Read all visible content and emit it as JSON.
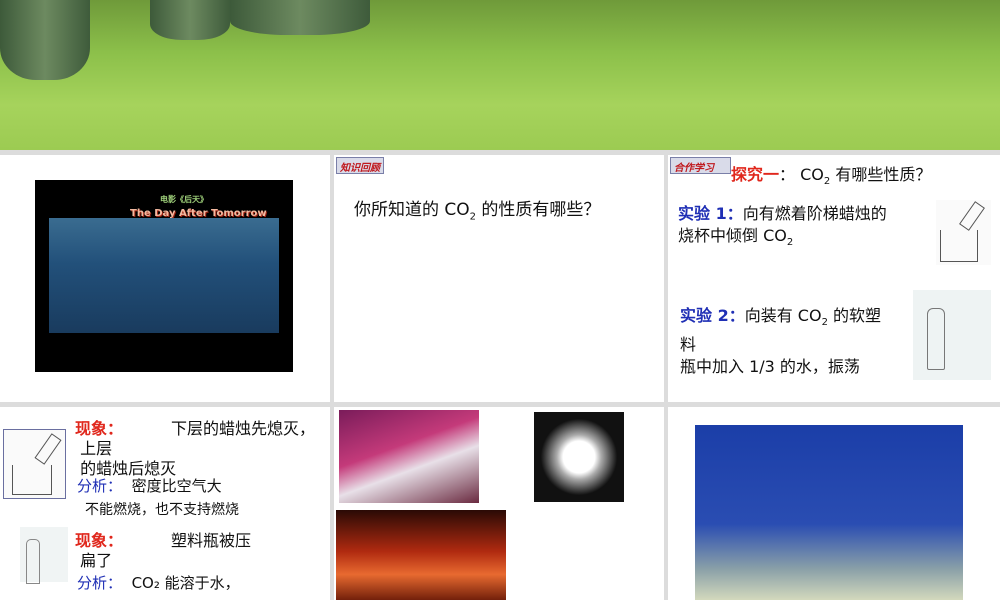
{
  "slide2": {
    "tag": "知识回顾",
    "question_pre": "你所知道的 CO",
    "question_sub": "2",
    "question_post": " 的性质有哪些？"
  },
  "slide1": {
    "movie_cn": "电影《后天》",
    "movie_en": "The Day After Tomorrow"
  },
  "slide3": {
    "tag": "合作学习",
    "title": "探究一",
    "title_colon": "：",
    "title_pre": " CO",
    "title_sub": "2",
    "title_post": " 有哪些性质？",
    "exp1_label": "实验 1：",
    "exp1_text_a": "向有燃着阶梯蜡烛的",
    "exp1_text_b": "烧杯中倾倒 CO",
    "exp1_sub": "2",
    "exp2_label": "实验 2：",
    "exp2_text_a": "向装有 CO",
    "exp2_sub": "2",
    "exp2_text_b": " 的软塑",
    "exp2_text_c": "料",
    "exp2_text_d": "瓶中加入 1/3 的水，振荡"
  },
  "slide4": {
    "phen1_label": "现象：",
    "phen1_a": "下层的蜡烛先熄灭，",
    "phen1_b": "上层",
    "phen1_c": "的蜡烛后熄灭",
    "anal1_label": "分析：",
    "anal1_a": "密度比空气大",
    "anal1_b": "不能燃烧，也不支持燃烧",
    "phen2_label": "现象：",
    "phen2_a": "塑料瓶被压",
    "phen2_b": "扁了",
    "anal2_label": "分析：",
    "anal2_a": "CO₂ 能溶于水，"
  }
}
